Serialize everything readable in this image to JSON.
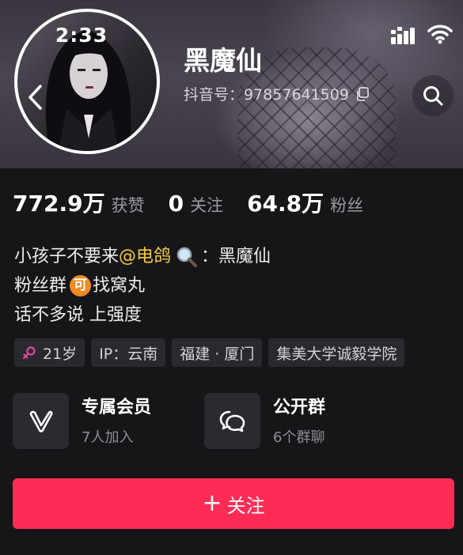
{
  "status_bar": {
    "time": "2:33"
  },
  "profile": {
    "nickname": "黑魔仙",
    "account_id": "抖音号：97857641509"
  },
  "stats": [
    {
      "value": "772.9万",
      "label": "获赞"
    },
    {
      "value": "0",
      "label": "关注"
    },
    {
      "value": "64.8万",
      "label": "粉丝"
    }
  ],
  "bio": {
    "line1_prefix": "小孩子不要来",
    "line1_mention": "@电鸽",
    "line1_suffix": "：黑魔仙",
    "line2_prefix": "粉丝群",
    "line2_badge": "可",
    "line2_suffix": "找窝丸",
    "line3": "话不多说 上强度"
  },
  "tags": [
    {
      "text": "21岁",
      "icon": "female-icon"
    },
    {
      "text": "IP：云南"
    },
    {
      "text": "福建 · 厦门"
    },
    {
      "text": "集美大学诚毅学院"
    }
  ],
  "features": [
    {
      "title": "专属会员",
      "subtitle": "7人加入",
      "icon": "vip-v-icon"
    },
    {
      "title": "公开群",
      "subtitle": "6个群聊",
      "icon": "group-chat-icon"
    }
  ],
  "follow_button": {
    "plus": "+",
    "label": "关注"
  },
  "colors": {
    "background": "#161619",
    "accent": "#fe2c55",
    "mention": "#f6c945",
    "badge": "#f08a24",
    "female": "#e24aa0"
  }
}
